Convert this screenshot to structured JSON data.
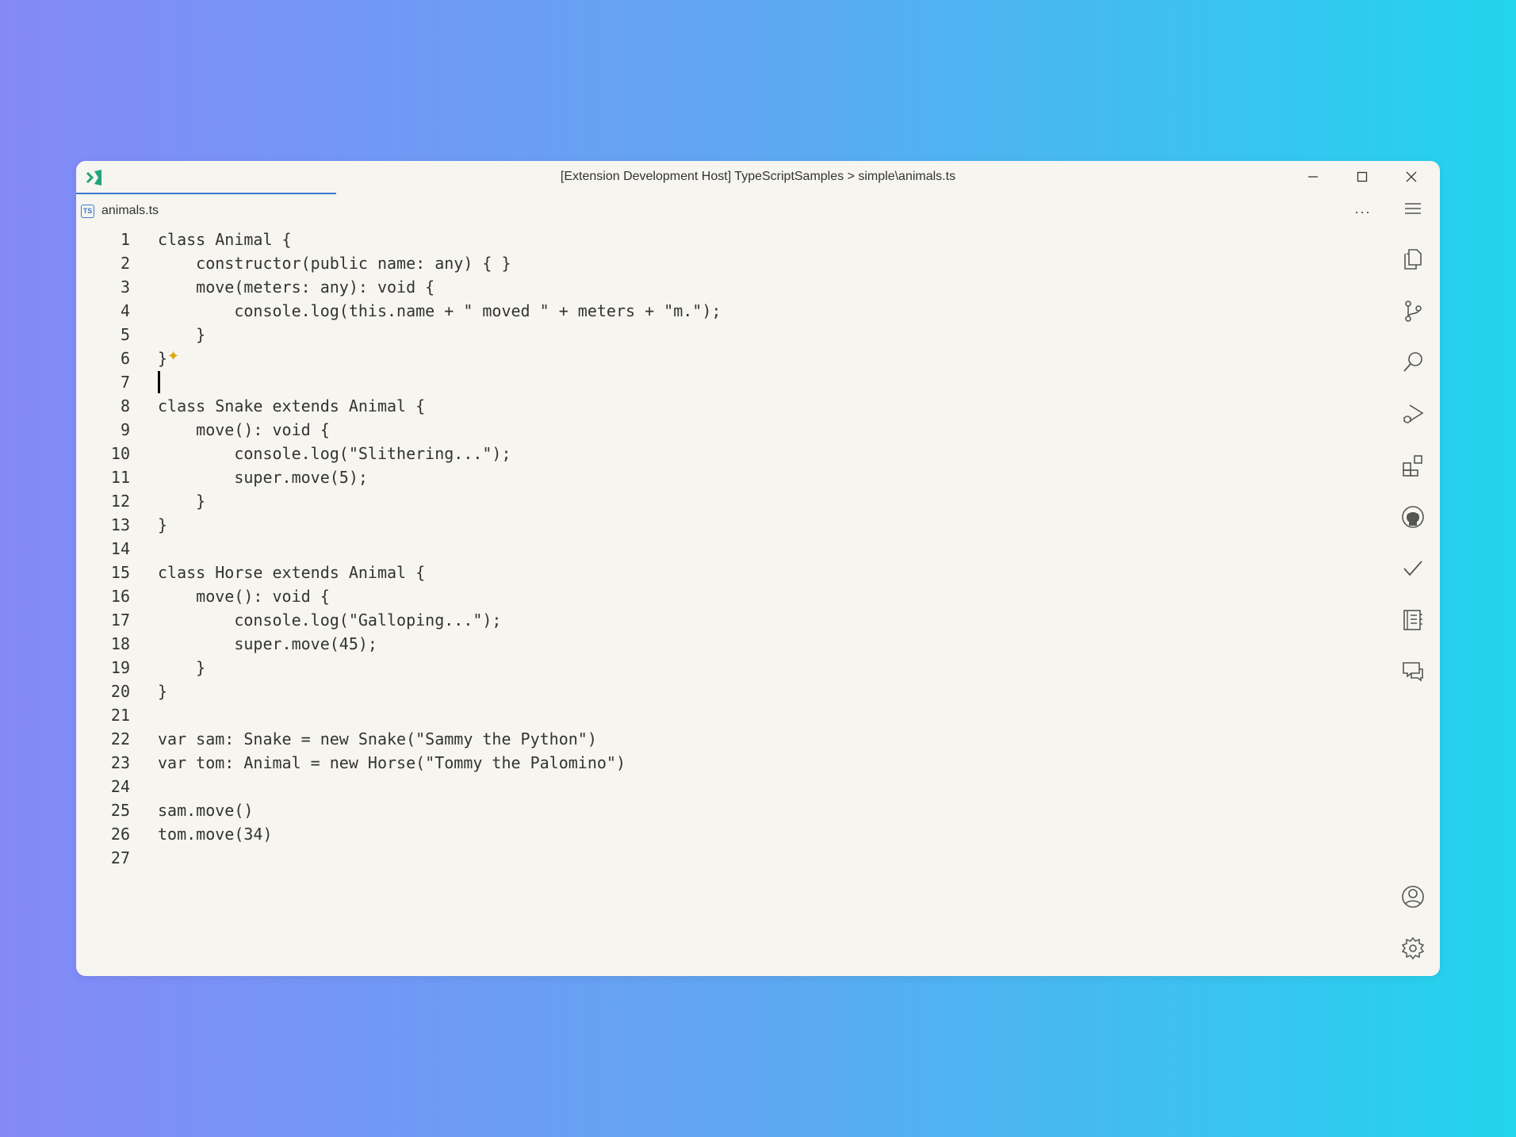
{
  "window": {
    "title": "[Extension Development Host] TypeScriptSamples > simple\\animals.ts"
  },
  "tab": {
    "label": "animals.ts",
    "icon": "typescript-file-icon",
    "icon_text": "TS"
  },
  "editor": {
    "more_label": "···",
    "line_numbers": [
      "1",
      "2",
      "3",
      "4",
      "5",
      "6",
      "7",
      "8",
      "9",
      "10",
      "11",
      "12",
      "13",
      "14",
      "15",
      "16",
      "17",
      "18",
      "19",
      "20",
      "21",
      "22",
      "23",
      "24",
      "25",
      "26",
      "27"
    ],
    "lines": [
      "class Animal {",
      "    constructor(public name: any) { }",
      "    move(meters: any): void {",
      "        console.log(this.name + \" moved \" + meters + \"m.\");",
      "    }",
      "}",
      "",
      "class Snake extends Animal {",
      "    move(): void {",
      "        console.log(\"Slithering...\");",
      "        super.move(5);",
      "    }",
      "}",
      "",
      "class Horse extends Animal {",
      "    move(): void {",
      "        console.log(\"Galloping...\");",
      "        super.move(45);",
      "    }",
      "}",
      "",
      "var sam: Snake = new Snake(\"Sammy the Python\")",
      "var tom: Animal = new Horse(\"Tommy the Palomino\")",
      "",
      "sam.move()",
      "tom.move(34)",
      ""
    ]
  },
  "activity_bar": {
    "items": [
      "menu-icon",
      "explorer-icon",
      "source-control-icon",
      "search-icon",
      "run-debug-icon",
      "extensions-icon",
      "github-icon",
      "testing-icon",
      "notebook-icon",
      "chat-icon"
    ],
    "bottom": [
      "account-icon",
      "settings-gear-icon"
    ]
  }
}
